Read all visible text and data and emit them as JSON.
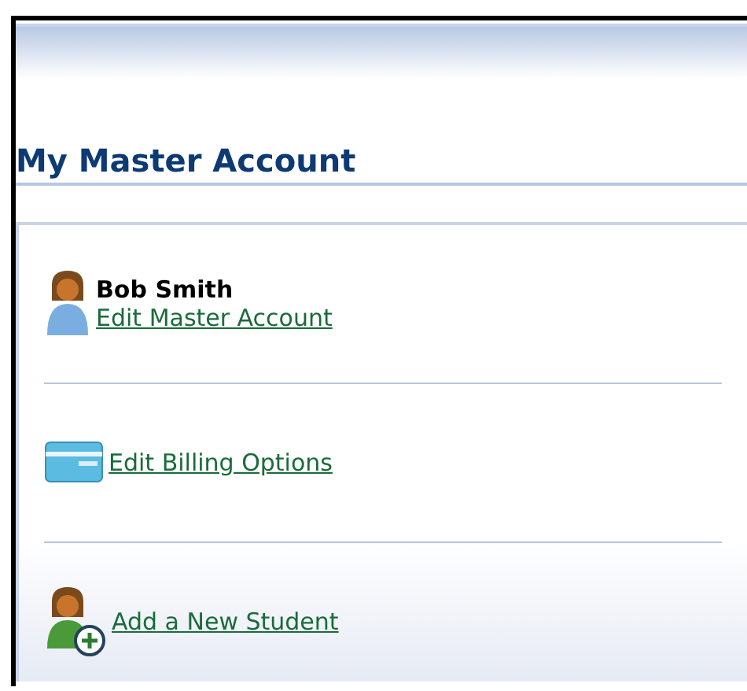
{
  "heading": "My Master Account",
  "items": [
    {
      "kind": "person",
      "name": "Bob Smith",
      "link": "Edit Master Account"
    },
    {
      "kind": "card",
      "link": "Edit Billing Options"
    },
    {
      "kind": "add-person",
      "link": "Add a New Student"
    }
  ]
}
